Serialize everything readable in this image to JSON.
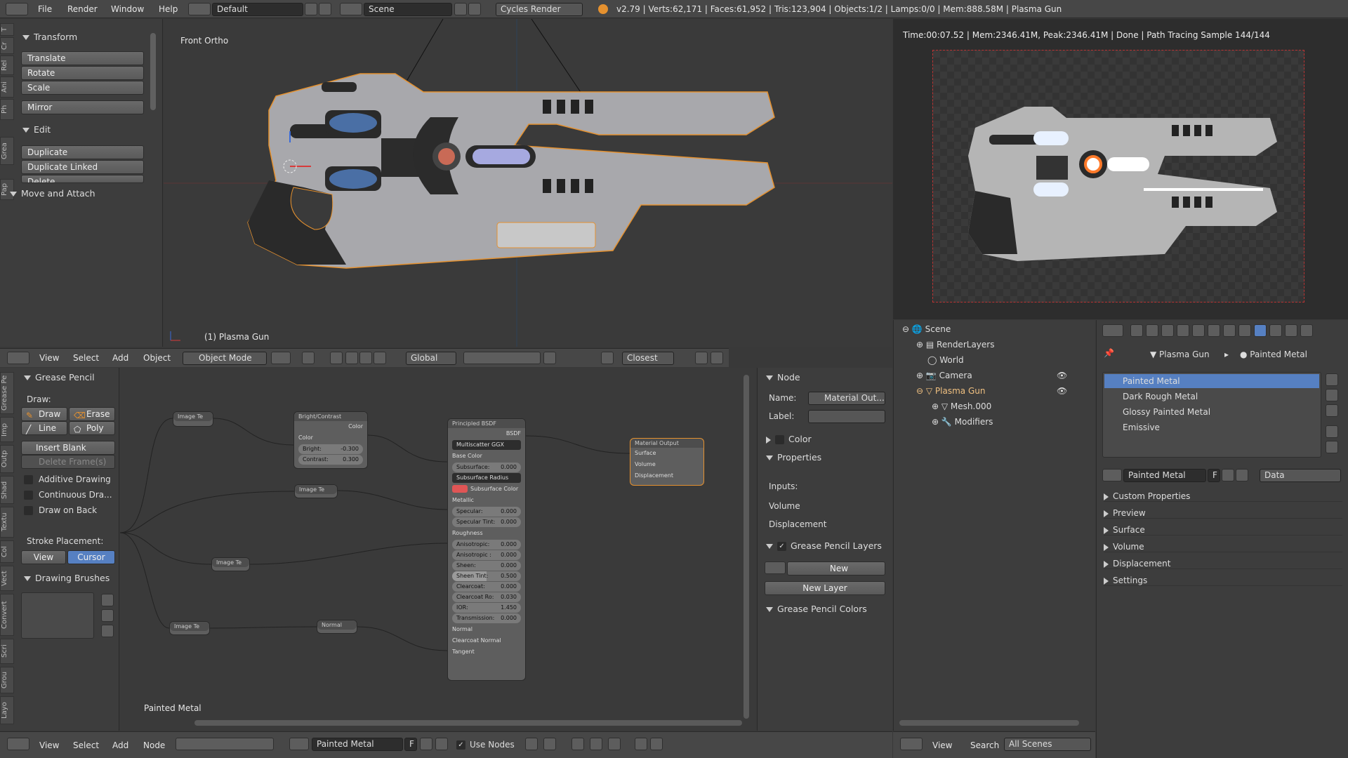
{
  "menu": {
    "file": "File",
    "render": "Render",
    "window": "Window",
    "help": "Help"
  },
  "screen_layout": "Default",
  "scene": "Scene",
  "engine": "Cycles Render",
  "stats": "v2.79 | Verts:62,171 | Faces:61,952 | Tris:123,904 | Objects:1/2 | Lamps:0/0 | Mem:888.58M | Plasma Gun",
  "toolshelf": {
    "tabs": [
      "T",
      "Cr",
      "Rel",
      "Ani",
      "Ph",
      "Grea",
      "Pap"
    ],
    "transform": "Transform",
    "translate": "Translate",
    "rotate": "Rotate",
    "scale": "Scale",
    "mirror": "Mirror",
    "edit": "Edit",
    "duplicate": "Duplicate",
    "duplicate_linked": "Duplicate Linked",
    "delete": "Delete",
    "move_attach": "Move and Attach"
  },
  "viewport": {
    "view_name": "Front Ortho",
    "object_label": "(1) Plasma Gun"
  },
  "render_view": {
    "status": "Time:00:07.52 | Mem:2346.41M, Peak:2346.41M | Done | Path Tracing Sample 144/144"
  },
  "view3d_header": {
    "view": "View",
    "select": "Select",
    "add": "Add",
    "object": "Object",
    "mode": "Object Mode",
    "orientation": "Global",
    "snap": "Closest"
  },
  "gp_panel": {
    "tabs": [
      "Grease Pe",
      "Imp",
      "Outp",
      "Shad",
      "Textu",
      "Col",
      "Vect",
      "Convert",
      "Scri",
      "Grou",
      "Layo"
    ],
    "title": "Grease Pencil",
    "draw_label": "Draw:",
    "draw": "Draw",
    "erase": "Erase",
    "line": "Line",
    "poly": "Poly",
    "insert_blank": "Insert Blank Frame",
    "delete_frames": "Delete Frame(s)",
    "additive": "Additive Drawing",
    "continuous": "Continuous Dra...",
    "draw_on_back": "Draw on Back",
    "stroke_placement": "Stroke Placement:",
    "view": "View",
    "cursor": "Cursor",
    "brushes": "Drawing Brushes"
  },
  "node_editor": {
    "material_label": "Painted Metal",
    "nodes": {
      "img1": "Image Te",
      "img2": "Image Te",
      "img3": "Image Te",
      "img4": "Image Te",
      "normal": "Normal",
      "bc_title": "Bright/Contrast",
      "bc_color": "Color",
      "bc_bright": "Bright:",
      "bc_bright_v": "-0.300",
      "bc_contrast": "Contrast:",
      "bc_contrast_v": "0.300",
      "bsdf_title": "Principled BSDF",
      "bsdf_out": "BSDF",
      "dist": "Multiscatter GGX",
      "base_color": "Base Color",
      "subsurface": "Subsurface:",
      "subsurface_v": "0.000",
      "ss_radius": "Subsurface Radius",
      "ss_color": "Subsurface Color",
      "metallic": "Metallic",
      "specular": "Specular:",
      "specular_v": "0.000",
      "spec_tint": "Specular Tint:",
      "spec_tint_v": "0.000",
      "roughness": "Roughness",
      "aniso": "Anisotropic:",
      "aniso_v": "0.000",
      "aniso_rot": "Anisotropic :",
      "aniso_rot_v": "0.000",
      "sheen": "Sheen:",
      "sheen_v": "0.000",
      "sheen_tint": "Sheen Tint:",
      "sheen_tint_v": "0.500",
      "clearcoat": "Clearcoat:",
      "clearcoat_v": "0.000",
      "cc_rough": "Clearcoat Ro:",
      "cc_rough_v": "0.030",
      "ior": "IOR:",
      "ior_v": "1.450",
      "transmission": "Transmission:",
      "transmission_v": "0.000",
      "normal_in": "Normal",
      "cc_normal": "Clearcoat Normal",
      "tangent": "Tangent",
      "out_title": "Material Output",
      "surface": "Surface",
      "volume": "Volume",
      "displacement": "Displacement"
    }
  },
  "node_props": {
    "node": "Node",
    "name_label": "Name:",
    "name_value": "Material Out...",
    "label_label": "Label:",
    "color": "Color",
    "properties": "Properties",
    "inputs": "Inputs:",
    "volume": "Volume",
    "displacement": "Displacement",
    "gp_layers": "Grease Pencil Layers",
    "new": "New",
    "new_layer": "New Layer",
    "gp_colors": "Grease Pencil Colors"
  },
  "node_header": {
    "view": "View",
    "select": "Select",
    "add": "Add",
    "node": "Node",
    "material": "Painted Metal",
    "f": "F",
    "use_nodes": "Use Nodes"
  },
  "outliner": {
    "items": [
      "Scene",
      "RenderLayers",
      "World",
      "Camera",
      "Plasma Gun",
      "Mesh.000",
      "Modifiers"
    ],
    "view": "View",
    "search": "Search",
    "filter": "All Scenes"
  },
  "properties": {
    "breadcrumb_obj": "Plasma Gun",
    "breadcrumb_mat": "Painted Metal",
    "materials": [
      "Painted Metal",
      "Dark Rough Metal",
      "Glossy Painted Metal",
      "Emissive"
    ],
    "material_field": "Painted Metal",
    "f": "F",
    "link": "Data",
    "sections": [
      "Custom Properties",
      "Preview",
      "Surface",
      "Volume",
      "Displacement",
      "Settings"
    ]
  },
  "colors": {
    "selected": "#5680c2",
    "accent_orange": "#e5912f",
    "panel_bg": "#393939",
    "header_bg": "#474747"
  }
}
